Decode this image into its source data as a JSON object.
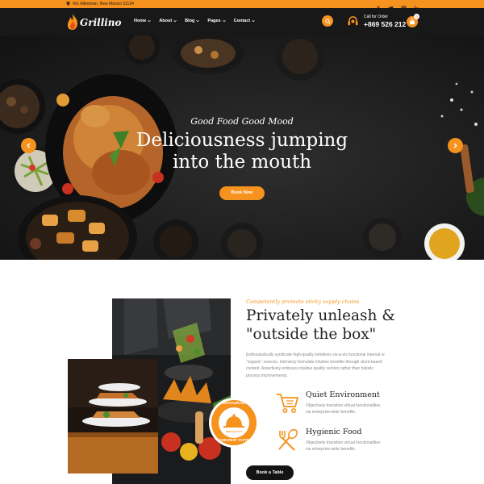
{
  "topbar": {
    "address": "Rd. Allentown, New Mexico 31134",
    "socials": [
      "facebook-icon",
      "twitter-icon",
      "instagram-icon",
      "linkedin-icon"
    ]
  },
  "brand": {
    "name": "Grillino"
  },
  "nav": {
    "items": [
      {
        "label": "Home"
      },
      {
        "label": "About"
      },
      {
        "label": "Blog"
      },
      {
        "label": "Pages"
      },
      {
        "label": "Contact"
      }
    ]
  },
  "call": {
    "label": "Call for Order",
    "number": "+869 526 212"
  },
  "cart": {
    "count": "0"
  },
  "hero": {
    "tagline": "Good Food Good Mood",
    "headline_line1": "Deliciousness jumping",
    "headline_line2": "into the mouth",
    "cta": "Book Now"
  },
  "about": {
    "eyebrow": "Competently promote sticky supply chains",
    "title_line1": "Privately unleash &",
    "title_line2": "\"outside the box\"",
    "body": "Enthusiastically syndicate high-quality initiatives vis-a-vis functional internal or \"organic\" sources. Intrinsicly formulate intuitive benefits through client-based content. Assertively embrace intuitive quality vectors rather than holistic process improvements.",
    "badge_top": "RESTAURANT",
    "badge_bottom": "GREATEST TASTE",
    "badge_center": "BEST QUALITY",
    "features": [
      {
        "icon": "shopping-cart-icon",
        "title": "Quiet Environment",
        "desc": "Objectively transition virtual functionalities via enterprise-wide benefits."
      },
      {
        "icon": "fork-spoon-icon",
        "title": "Hygienic Food",
        "desc": "Objectively transition virtual functionalities via enterprise-wide benefits."
      }
    ],
    "button": "Book a Table"
  },
  "colors": {
    "accent": "#f6921e",
    "dark": "#181818",
    "text": "#222222",
    "muted": "#8a8a8a"
  }
}
